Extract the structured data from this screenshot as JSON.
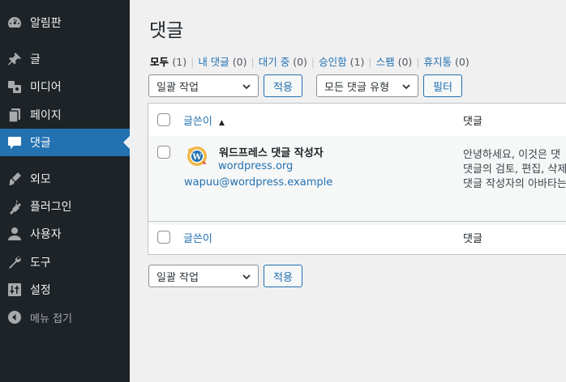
{
  "sidebar": {
    "cut_text": "······· ·······",
    "items": [
      {
        "label": "알림판",
        "icon": "dashboard-icon"
      },
      {
        "label": "글",
        "icon": "pin-icon"
      },
      {
        "label": "미디어",
        "icon": "media-icon"
      },
      {
        "label": "페이지",
        "icon": "pages-icon"
      },
      {
        "label": "댓글",
        "icon": "comments-icon",
        "active": true
      },
      {
        "label": "외모",
        "icon": "appearance-icon"
      },
      {
        "label": "플러그인",
        "icon": "plugins-icon"
      },
      {
        "label": "사용자",
        "icon": "users-icon"
      },
      {
        "label": "도구",
        "icon": "tools-icon"
      },
      {
        "label": "설정",
        "icon": "settings-icon"
      },
      {
        "label": "메뉴 접기",
        "icon": "collapse-icon"
      }
    ]
  },
  "page": {
    "title": "댓글"
  },
  "filters": [
    {
      "label": "모두",
      "count": "(1)",
      "current": true
    },
    {
      "label": "내 댓글",
      "count": "(0)"
    },
    {
      "label": "대기 중",
      "count": "(0)"
    },
    {
      "label": "승인함",
      "count": "(1)"
    },
    {
      "label": "스팸",
      "count": "(0)"
    },
    {
      "label": "휴지통",
      "count": "(0)"
    }
  ],
  "tablenav_top": {
    "bulk_select": "일괄 작업",
    "apply": "적용",
    "type_select": "모든 댓글 유형",
    "filter": "필터"
  },
  "tablenav_bottom": {
    "bulk_select": "일괄 작업",
    "apply": "적용"
  },
  "table": {
    "col_author": "글쓴이",
    "col_comment": "댓글",
    "rows": [
      {
        "author_name": "워드프레스 댓글 작성자",
        "author_url": "wordpress.org",
        "author_email": "wapuu@wordpress.example",
        "comment_lines": [
          "안녕하세요, 이것은 댓",
          "댓글의 검토, 편집, 삭제",
          "댓글 작성자의 아바타는"
        ]
      }
    ]
  },
  "colors": {
    "sidebar_bg": "#1d2327",
    "accent": "#2271b1",
    "page_bg": "#f0f0f1"
  }
}
